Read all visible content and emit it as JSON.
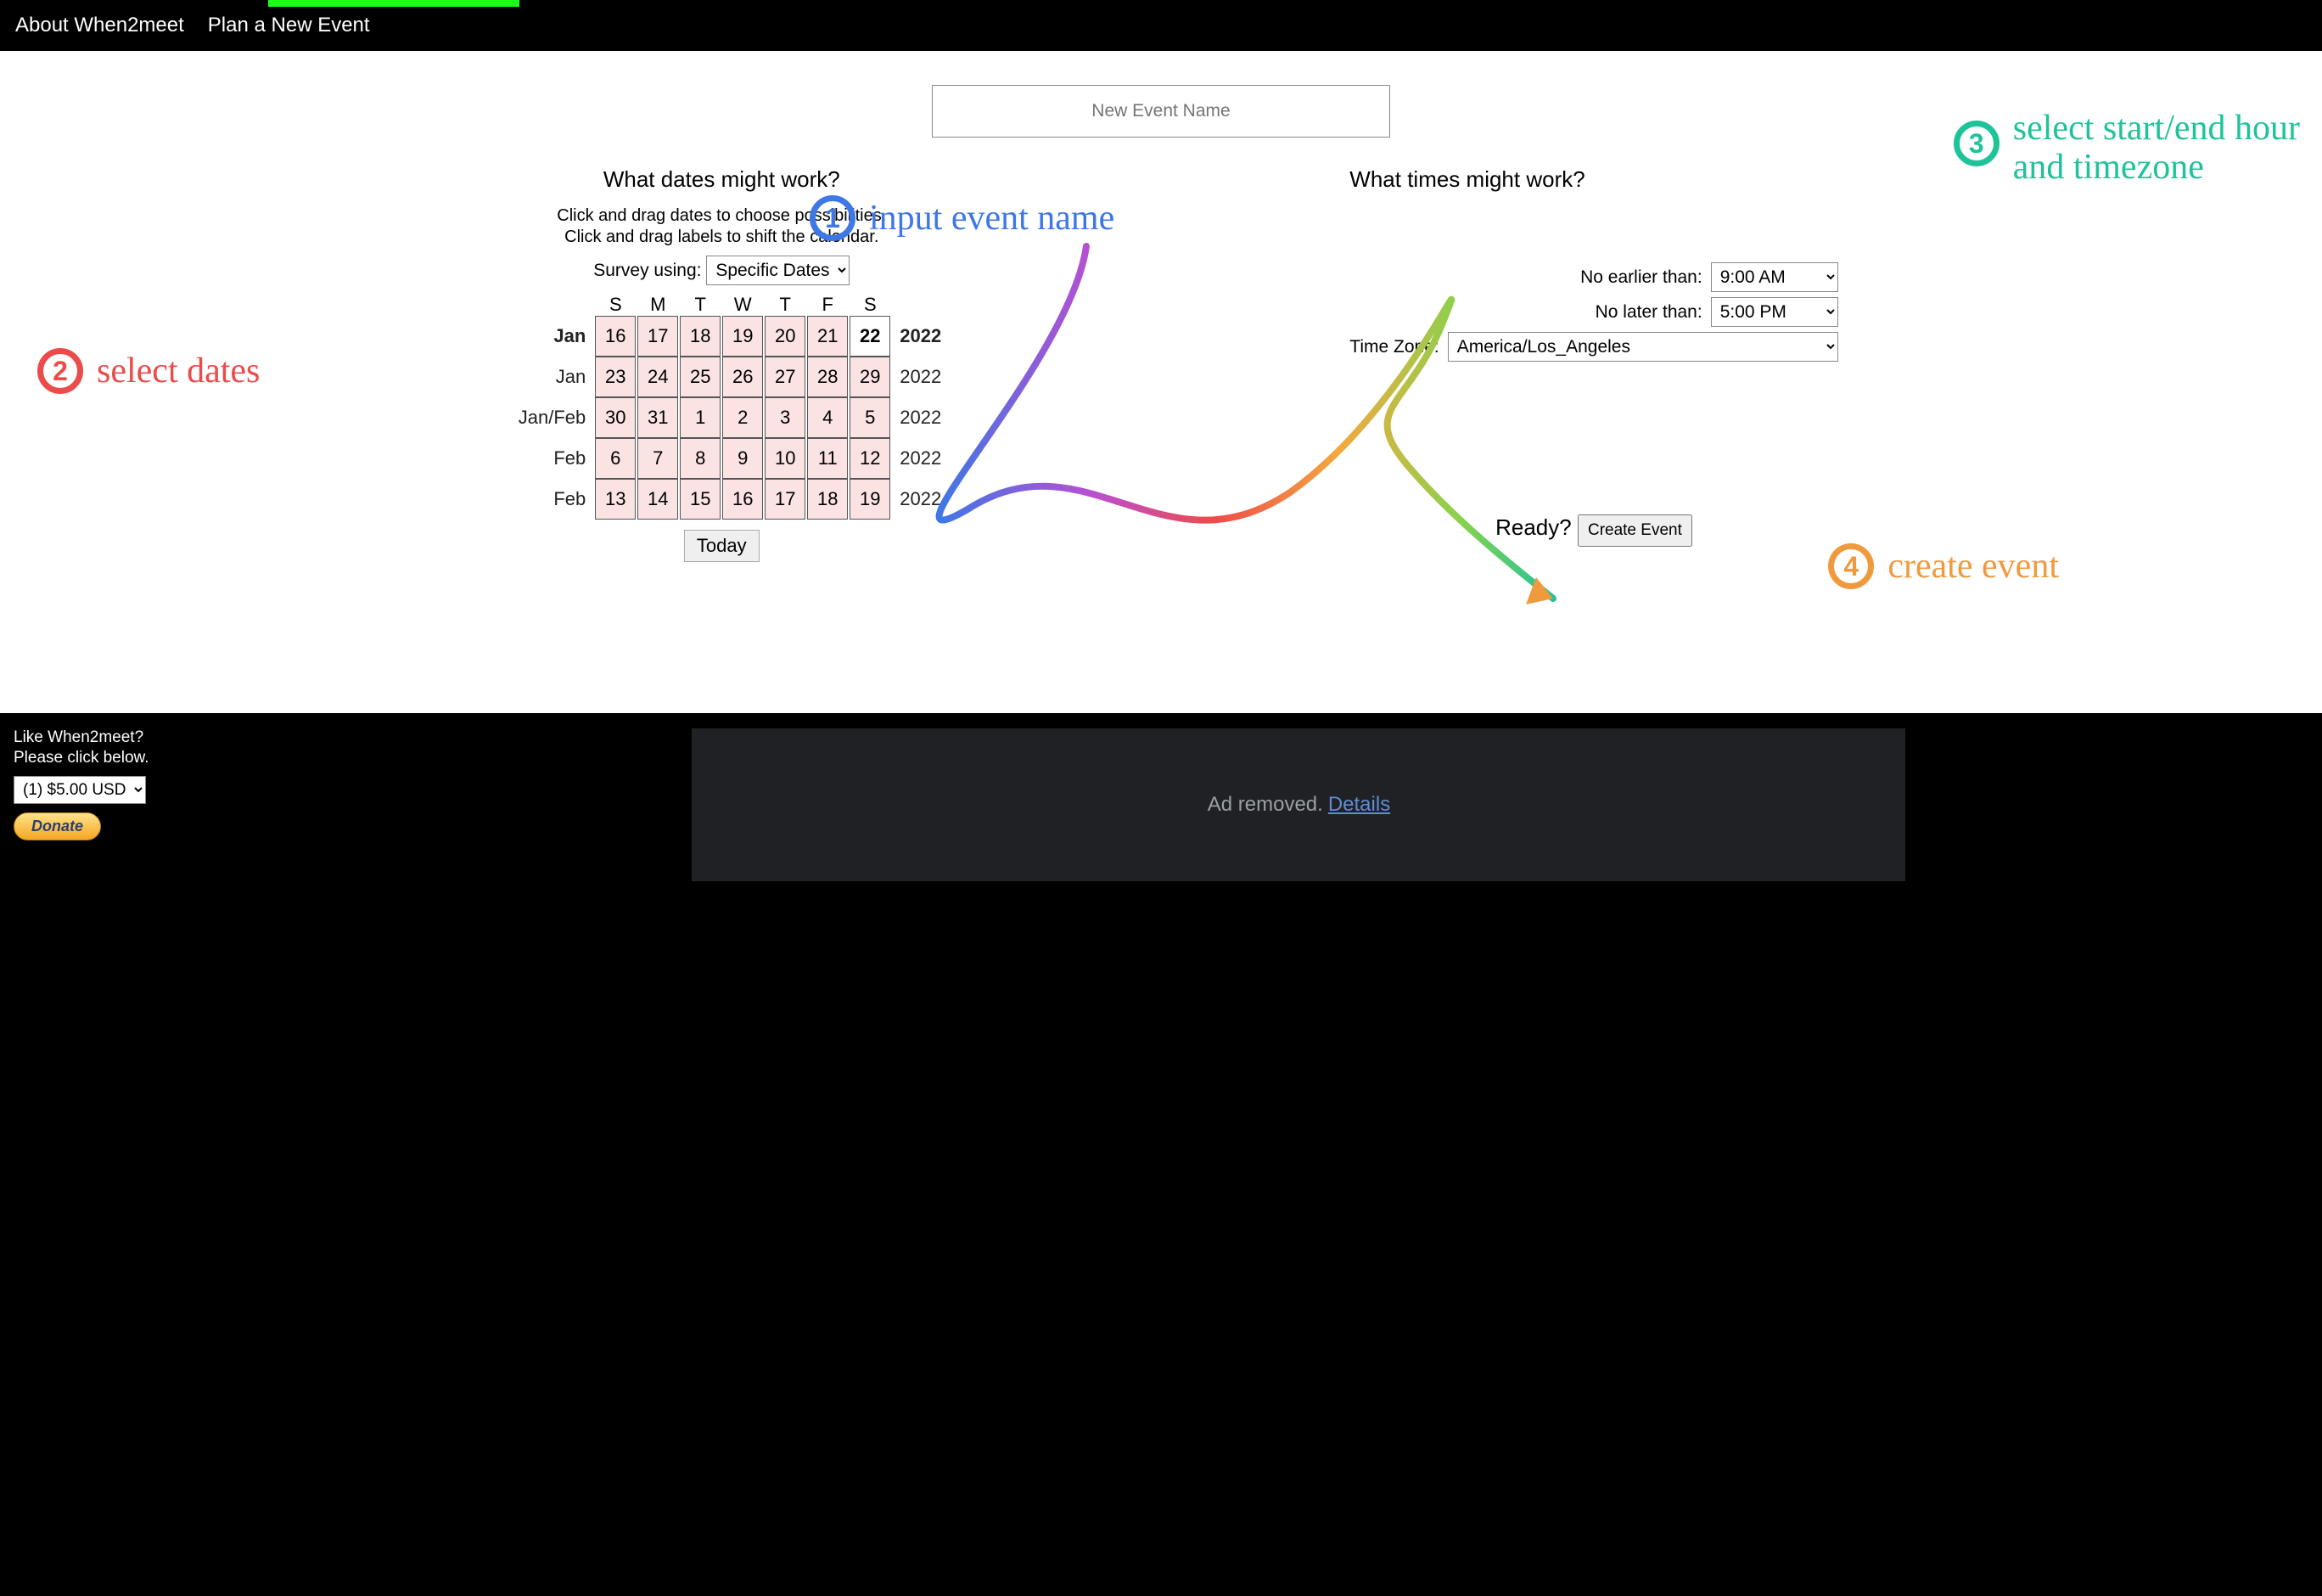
{
  "accent_color": "#19ff19",
  "nav": {
    "about": "About When2meet",
    "plan": "Plan a New Event"
  },
  "event_name_placeholder": "New Event Name",
  "annotations": {
    "a1": "input event name",
    "a2": "select dates",
    "a3_l1": "select start/end hour",
    "a3_l2": "and timezone",
    "a4": "create event"
  },
  "dates_panel": {
    "title": "What dates might work?",
    "hint1": "Click and drag dates to choose possibilities.",
    "hint2": "Click and drag labels to shift the calendar.",
    "survey_label": "Survey using:",
    "survey_value": "Specific Dates",
    "day_headers": [
      "S",
      "M",
      "T",
      "W",
      "T",
      "F",
      "S"
    ],
    "rows": [
      {
        "left": "Jan",
        "leftBold": true,
        "right": "2022",
        "rightBold": true,
        "days": [
          16,
          17,
          18,
          19,
          20,
          21,
          22
        ],
        "today": 22
      },
      {
        "left": "Jan",
        "right": "2022",
        "days": [
          23,
          24,
          25,
          26,
          27,
          28,
          29
        ]
      },
      {
        "left": "Jan/Feb",
        "right": "2022",
        "days": [
          30,
          31,
          1,
          2,
          3,
          4,
          5
        ]
      },
      {
        "left": "Feb",
        "right": "2022",
        "days": [
          6,
          7,
          8,
          9,
          10,
          11,
          12
        ]
      },
      {
        "left": "Feb",
        "right": "2022",
        "days": [
          13,
          14,
          15,
          16,
          17,
          18,
          19
        ]
      }
    ],
    "today_btn": "Today"
  },
  "times_panel": {
    "title": "What times might work?",
    "no_earlier_label": "No earlier than:",
    "no_earlier_value": "9:00 AM",
    "no_later_label": "No later than:",
    "no_later_value": "5:00 PM",
    "tz_label": "Time Zone:",
    "tz_value": "America/Los_Angeles",
    "ready_label": "Ready?",
    "create_btn": "Create Event"
  },
  "footer": {
    "like1": "Like When2meet?",
    "like2": "Please click below.",
    "donate_option": "(1) $5.00 USD",
    "donate_btn": "Donate",
    "ad_text": "Ad removed.",
    "ad_link": "Details"
  }
}
